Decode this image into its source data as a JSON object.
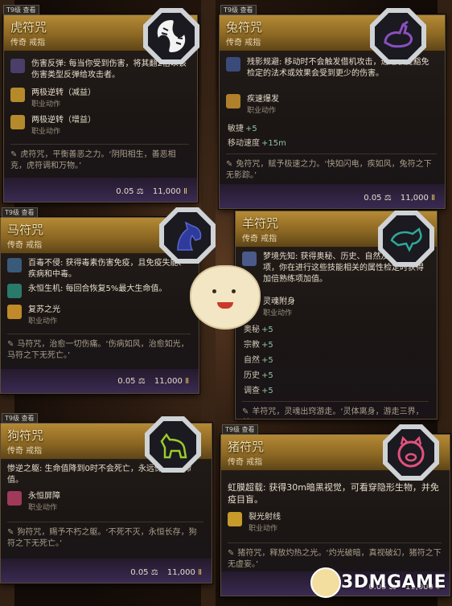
{
  "cards": {
    "tiger": {
      "tag": "T9级 查看",
      "title": "虎符咒",
      "subtitle": "传奇 戒指",
      "emblem_color": "#f4f4f4",
      "emblem_icon": "tiger-icon",
      "row1": "伤害反弹: 每当你受到伤害，将其翻2倍以该伤害类型反弹给攻击者。",
      "row2_name": "两极逆转（减益）",
      "row2_kind": "职业动作",
      "row3_name": "两极逆转（增益）",
      "row3_kind": "职业动作",
      "quote": "虎符咒，平衡善恶之力。‘阴阳相生，善恶相克，虎符调和万物。’",
      "weight": "0.05",
      "price": "11,000"
    },
    "rabbit": {
      "tag": "T9级 查看",
      "title": "兔符咒",
      "subtitle": "传奇 戒指",
      "emblem_color": "#8a4fbf",
      "emblem_icon": "rabbit-icon",
      "row1": "残影规避: 移动时不会触发借机攻击，通过敏捷豁免检定的法术或效果会受到更少的伤害。",
      "row2_name": "疾速爆发",
      "row2_kind": "职业动作",
      "stat1_label": "敏捷",
      "stat1_value": "+5",
      "stat2_label": "移动速度",
      "stat2_value": "+15m",
      "quote": "兔符咒，赋予极速之力。‘快如闪电，疾如风，兔符之下无影踪。’",
      "weight": "0.05",
      "price": "11,000"
    },
    "horse": {
      "tag": "T9级 查看",
      "title": "马符咒",
      "subtitle": "传奇 戒指",
      "emblem_color": "#2e3a9c",
      "emblem_icon": "horse-icon",
      "row1": "百毒不侵: 获得毒素伤害免疫，且免疫失能、疾病和中毒。",
      "row2": "永恒生机: 每回合恢复5%最大生命值。",
      "row3_name": "复苏之光",
      "row3_kind": "职业动作",
      "quote": "马符咒，治愈一切伤痛。‘伤病如风，治愈如光，马符之下无死亡。’",
      "weight": "0.05",
      "price": "11,000"
    },
    "goat": {
      "tag": "T9级 查看",
      "title": "羊符咒",
      "subtitle": "传奇 戒指",
      "emblem_color": "#2fa89b",
      "emblem_icon": "goat-icon",
      "row1": "梦境先知: 获得奥秘、历史、自然及宗教熟练项，你在进行这些技能相关的属性检定时获得加倍熟练项加值。",
      "row2_name": "灵魂附身",
      "row2_kind": "职业动作",
      "stats": [
        {
          "label": "奥秘",
          "value": "+5"
        },
        {
          "label": "宗教",
          "value": "+5"
        },
        {
          "label": "自然",
          "value": "+5"
        },
        {
          "label": "历史",
          "value": "+5"
        },
        {
          "label": "调查",
          "value": "+5"
        }
      ],
      "quote": "羊符咒，灵魂出窍游走。‘灵体离身，游走三界，羊’"
    },
    "dog": {
      "tag": "T9级 查看",
      "title": "狗符咒",
      "subtitle": "传奇 戒指",
      "emblem_color": "#9acb2c",
      "emblem_icon": "dog-icon",
      "row1": "惨逆之躯: 生命值降到0时不会死亡，永远保留1生命值。",
      "row2_name": "永恒屏障",
      "row2_kind": "职业动作",
      "quote": "狗符咒，赐予不朽之躯。‘不死不灭，永恒长存，狗符之下无死亡。’",
      "weight": "0.05",
      "price": "11,000"
    },
    "pig": {
      "tag": "T9级 查看",
      "title": "猪符咒",
      "subtitle": "传奇 戒指",
      "emblem_color": "#e2517c",
      "emblem_icon": "pig-icon",
      "row1": "虹膜超载: 获得30m暗黑视觉，可看穿隐形生物，并免疫目盲。",
      "row2_name": "裂光射线",
      "row2_kind": "职业动作",
      "quote": "猪符咒，释放灼热之光。‘灼光破暗，真视破幻，猪符之下无虚妄。’",
      "weight": "0.05",
      "price": "11,000"
    }
  },
  "watermark": "3DMGAME",
  "colors": {
    "header": "#a37a2e",
    "stat_value": "#8fc3a8",
    "bottom_band": "#3a2a52"
  }
}
